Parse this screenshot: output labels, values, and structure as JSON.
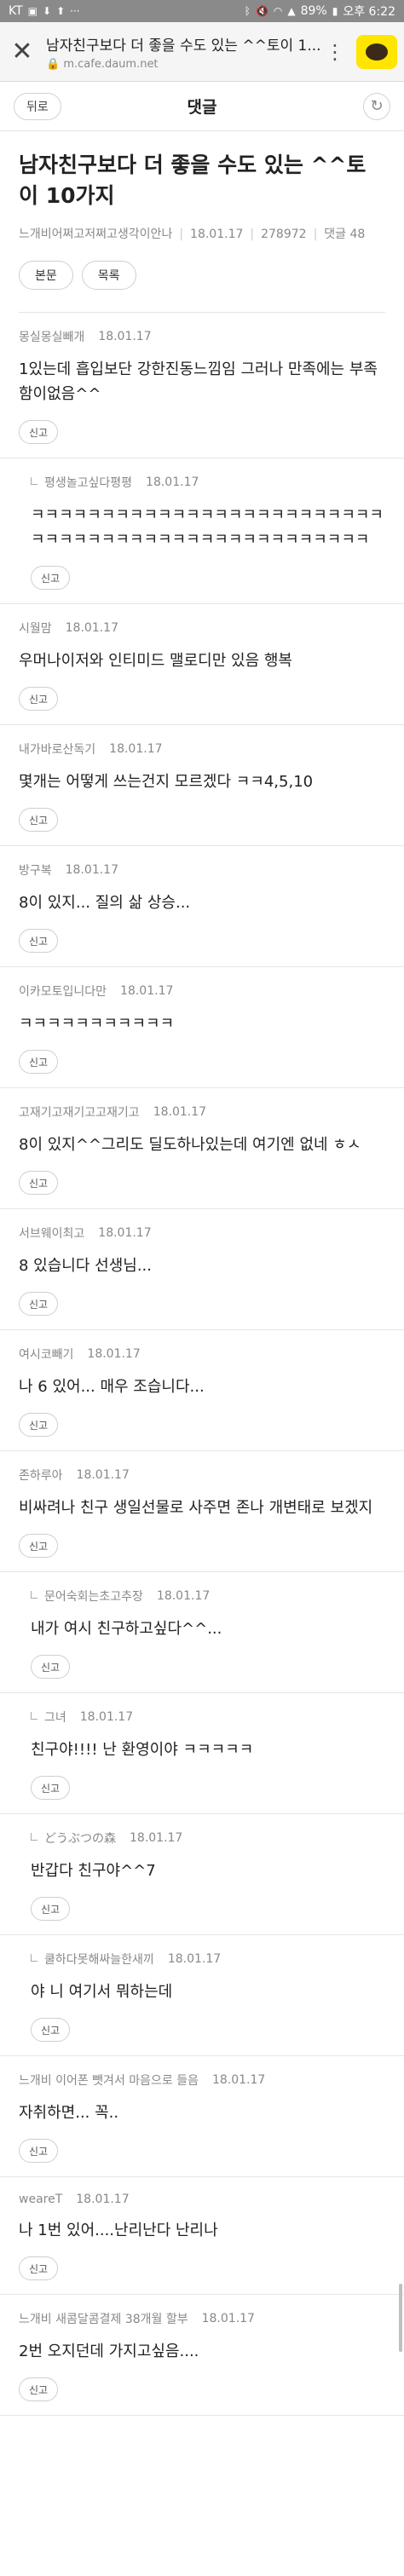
{
  "status_bar": {
    "carrier": "KT",
    "battery": "89%",
    "time": "오후 6:22"
  },
  "browser": {
    "tab_title": "남자친구보다 더 좋을 수도 있는 ^^토이 1...",
    "host": "m.cafe.daum.net",
    "close_icon": "close-icon",
    "menu_icon": "kebab-icon",
    "app_icon": "kakaotalk-icon",
    "accent": "#ffe500"
  },
  "nav": {
    "back_label": "뒤로",
    "title": "댓글",
    "refresh_icon": "refresh-icon"
  },
  "post": {
    "title": "남자친구보다 더 좋을 수도 있는 ^^토이 10가지",
    "author": "느개비어쩌고저쩌고생각이안나",
    "date": "18.01.17",
    "views": "278972",
    "comment_count": "댓글 48",
    "btn_body": "본문",
    "btn_list": "목록"
  },
  "report_label": "신고",
  "comments": [
    {
      "author": "몽실몽실빼개",
      "date": "18.01.17",
      "body": "1있는데 흡입보단 강한진동느낌임 그러나 만족에는 부족함이없음^^",
      "reply": false
    },
    {
      "author": "평생놀고싶다평평",
      "date": "18.01.17",
      "body": "ㅋㅋㅋㅋㅋㅋㅋㅋㅋㅋㅋㅋㅋㅋㅋㅋㅋㅋㅋㅋㅋㅋㅋㅋㅋㅋㅋㅋㅋㅋㅋㅋㅋㅋㅋㅋㅋㅋㅋㅋㅋㅋㅋㅋㅋㅋㅋㅋㅋ",
      "reply": true
    },
    {
      "author": "시월맘",
      "date": "18.01.17",
      "body": "우머나이저와 인티미드 맬로디만 있음 행복",
      "reply": false
    },
    {
      "author": "내가바로산독기",
      "date": "18.01.17",
      "body": "몇개는 어떻게 쓰는건지 모르겠다 ㅋㅋ4,5,10",
      "reply": false
    },
    {
      "author": "방구복",
      "date": "18.01.17",
      "body": "8이 있지... 질의 삶 상승...",
      "reply": false
    },
    {
      "author": "이카모토입니다만",
      "date": "18.01.17",
      "body": "ㅋㅋㅋㅋㅋㅋㅋㅋㅋㅋㅋ",
      "reply": false
    },
    {
      "author": "고재기고재기고고재기고",
      "date": "18.01.17",
      "body": "8이 있지^^그리도 딜도하나있는데 여기엔 없네 ㅎㅅ",
      "reply": false
    },
    {
      "author": "서브웨이최고",
      "date": "18.01.17",
      "body": "8 있습니다 선생님...",
      "reply": false
    },
    {
      "author": "여시코빼기",
      "date": "18.01.17",
      "body": "나 6 있어... 매우 조습니다...",
      "reply": false
    },
    {
      "author": "존하루아",
      "date": "18.01.17",
      "body": "비싸려나 친구 생일선물로 사주면 존나 개변태로 보겠지",
      "reply": false
    },
    {
      "author": "문어숙회는초고추장",
      "date": "18.01.17",
      "body": "내가 여시 친구하고싶다^^...",
      "reply": true
    },
    {
      "author": "그녀",
      "date": "18.01.17",
      "body": "친구야!!!! 난 환영이야 ㅋㅋㅋㅋㅋ",
      "reply": true
    },
    {
      "author": "どうぶつの森",
      "date": "18.01.17",
      "body": "반갑다 친구야^^7",
      "reply": true
    },
    {
      "author": "쿨하다못해싸늘한새끼",
      "date": "18.01.17",
      "body": "야 니 여기서 뭐하는데",
      "reply": true
    },
    {
      "author": "느개비 이어폰 뺏겨서 마음으로 들음",
      "date": "18.01.17",
      "body": "자취하면... 꼭..",
      "reply": false
    },
    {
      "author": "weareT",
      "date": "18.01.17",
      "body": "나 1번 있어....난리난다 난리나",
      "reply": false
    },
    {
      "author": "느개비 새콤달콤결제 38개월 할부",
      "date": "18.01.17",
      "body": "2번 오지던데 가지고싶음....",
      "reply": false
    }
  ]
}
